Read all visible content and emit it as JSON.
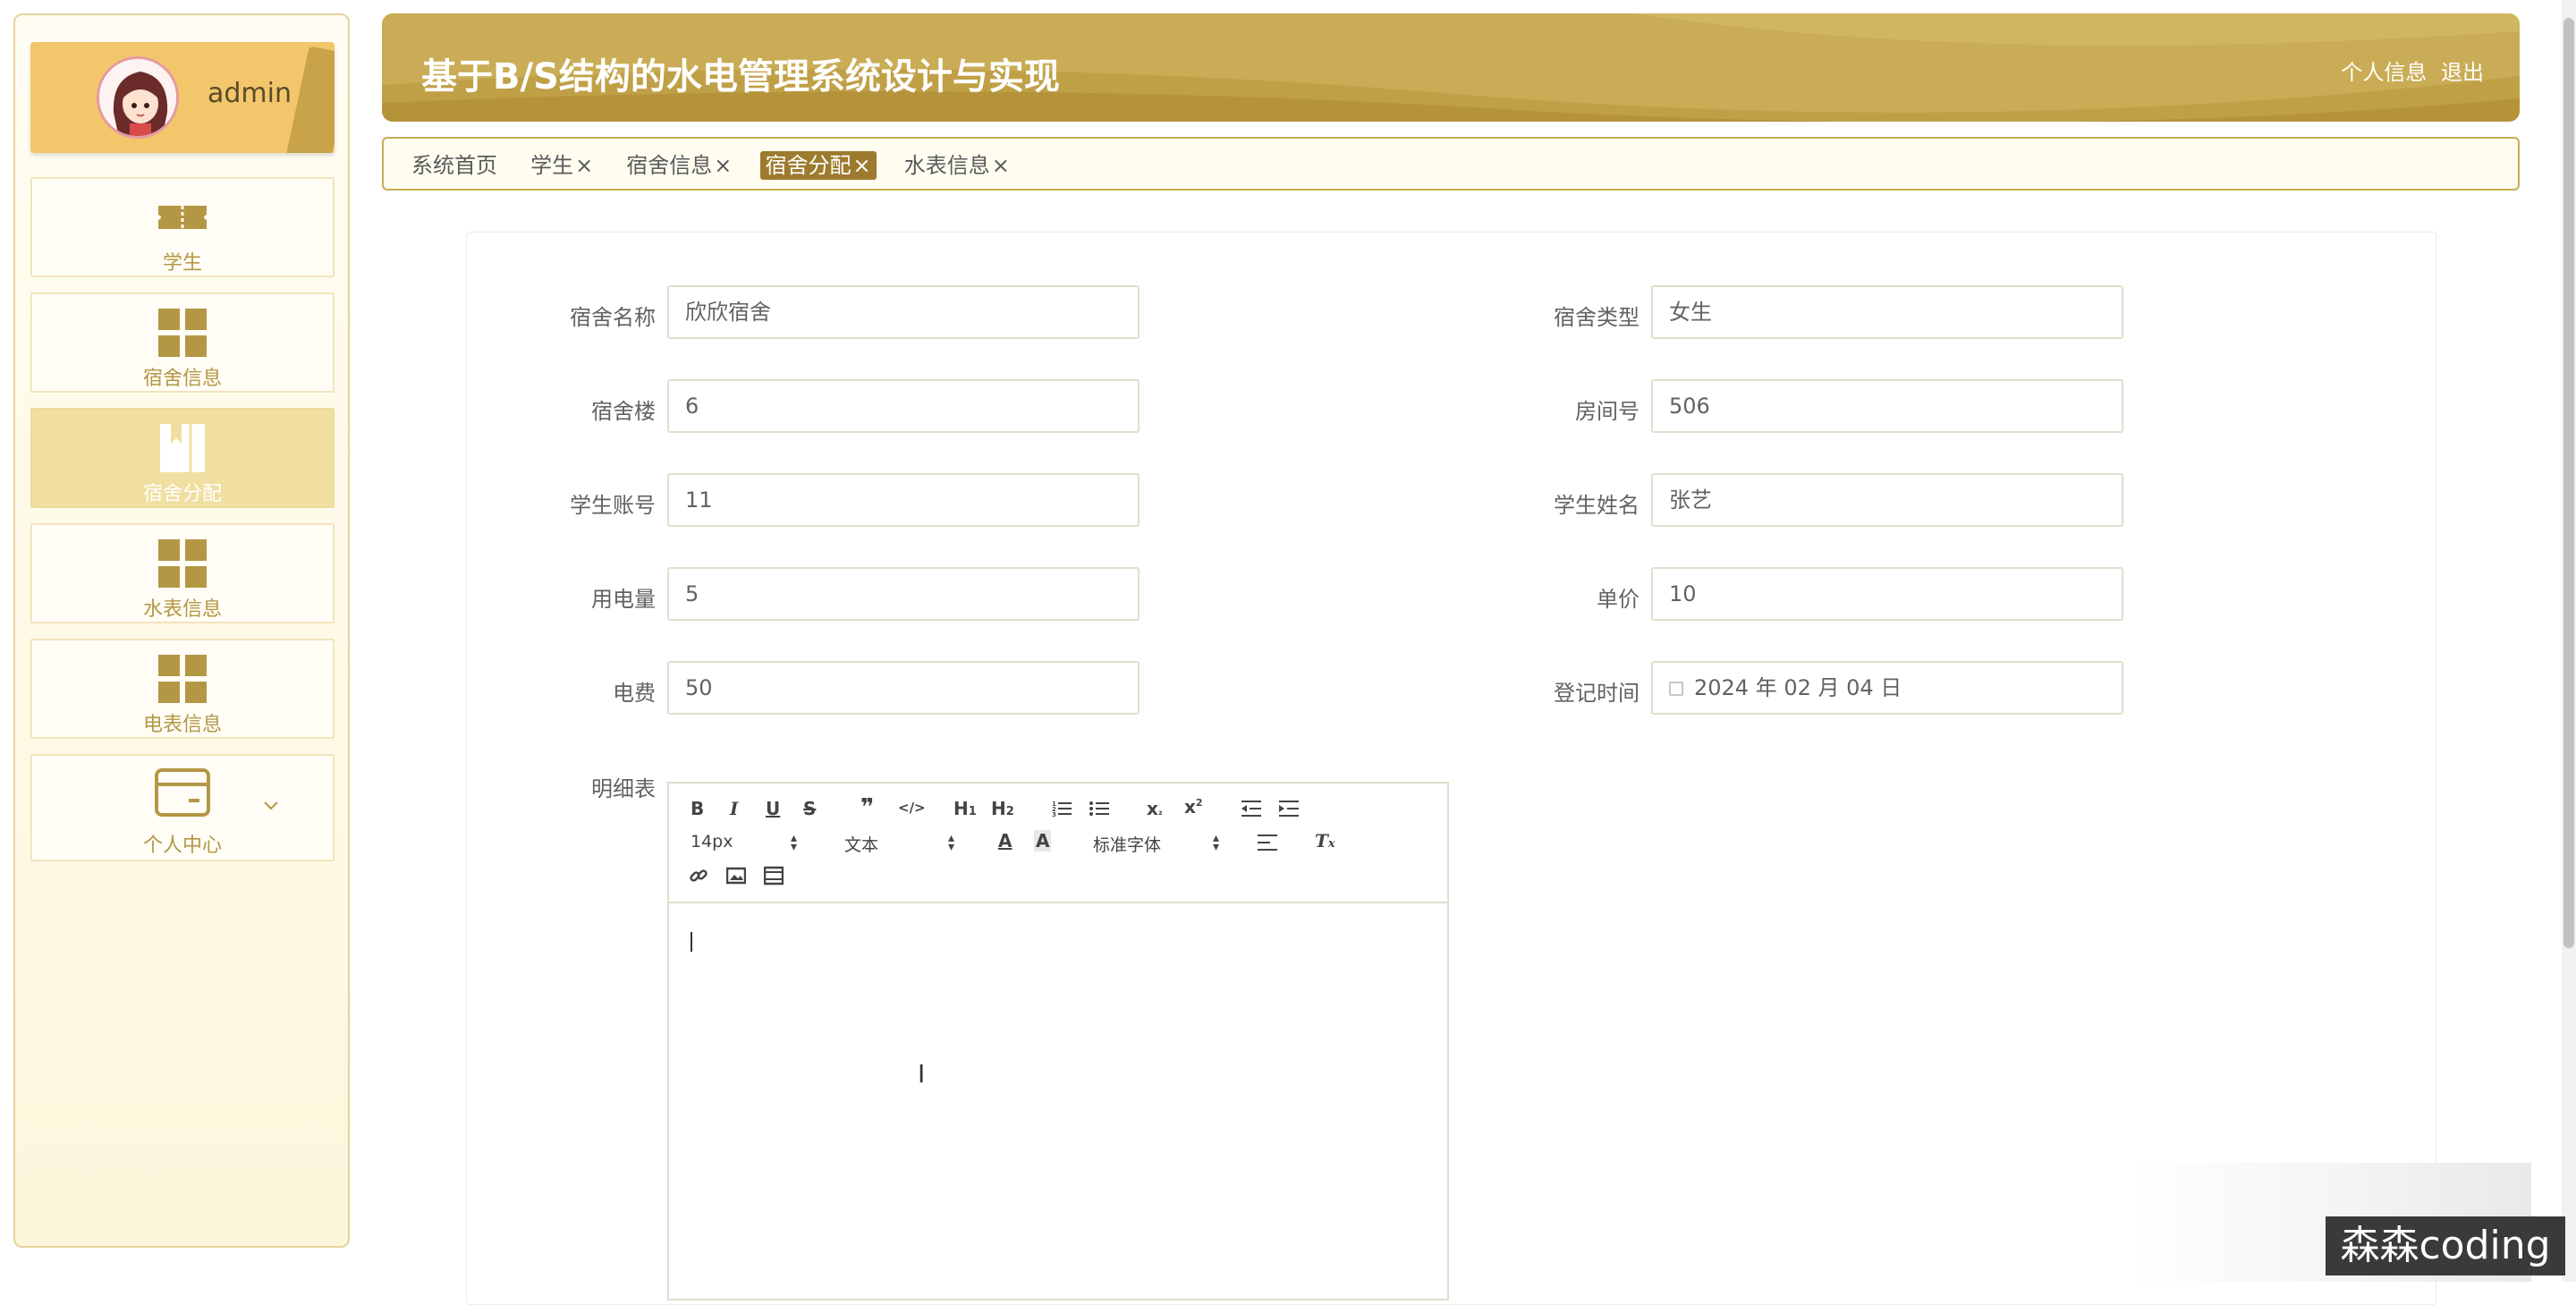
{
  "header": {
    "title": "基于B/S结构的水电管理系统设计与实现",
    "profile_link": "个人信息",
    "logout_link": "退出",
    "color": "#c9ac55"
  },
  "sidebar": {
    "username": "admin",
    "items": [
      {
        "label": "学生",
        "icon": "ticket-icon"
      },
      {
        "label": "宿舍信息",
        "icon": "grid-icon"
      },
      {
        "label": "宿舍分配",
        "icon": "book-icon",
        "active": true
      },
      {
        "label": "水表信息",
        "icon": "grid-icon"
      },
      {
        "label": "电表信息",
        "icon": "grid-icon"
      },
      {
        "label": "个人中心",
        "icon": "card-icon"
      }
    ]
  },
  "tabs": [
    {
      "label": "系统首页",
      "closable": false
    },
    {
      "label": "学生",
      "closable": true
    },
    {
      "label": "宿舍信息",
      "closable": true
    },
    {
      "label": "宿舍分配",
      "closable": true,
      "active": true
    },
    {
      "label": "水表信息",
      "closable": true
    }
  ],
  "tab_close": "×",
  "form": {
    "dorm_name": {
      "label": "宿舍名称",
      "value": "欣欣宿舍"
    },
    "dorm_type": {
      "label": "宿舍类型",
      "value": "女生"
    },
    "building": {
      "label": "宿舍楼",
      "value": "6"
    },
    "room_no": {
      "label": "房间号",
      "value": "506"
    },
    "student_account": {
      "label": "学生账号",
      "value": "11"
    },
    "student_name": {
      "label": "学生姓名",
      "value": "张艺"
    },
    "power_usage": {
      "label": "用电量",
      "value": "5"
    },
    "unit_price": {
      "label": "单价",
      "value": "10"
    },
    "power_fee": {
      "label": "电费",
      "value": "50"
    },
    "register_time": {
      "label": "登记时间",
      "value": "2024 年 02 月 04 日"
    },
    "details": {
      "label": "明细表"
    }
  },
  "editor": {
    "font_size": "14px",
    "paragraph": "文本",
    "font_family": "标准字体",
    "buttons": [
      "B",
      "I",
      "U",
      "S",
      "❞",
      "</>",
      "H1",
      "H2",
      "ol",
      "ul",
      "x₂",
      "x²",
      "outdent",
      "indent",
      "A",
      "A",
      "align",
      "Tx",
      "link",
      "image",
      "video"
    ]
  },
  "watermark": "森森coding"
}
